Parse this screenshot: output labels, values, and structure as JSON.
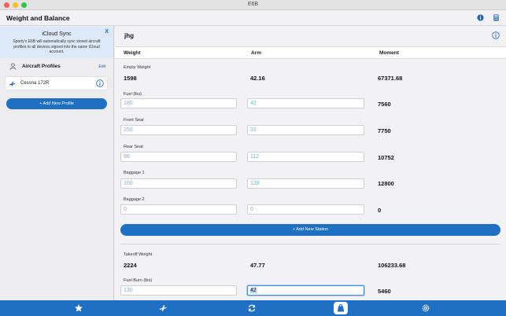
{
  "window": {
    "title": "E6B"
  },
  "header": {
    "title": "Weight and Balance"
  },
  "sidebar": {
    "icloud": {
      "title": "iCloud Sync",
      "description": "Sporty's E6B will automatically sync stored aircraft profiles to all devices signed into the same iCloud account.",
      "close_label": "X"
    },
    "profiles_label": "Aircraft Profiles",
    "edit_label": "Edit",
    "profiles": [
      {
        "name": "Cessna 172R"
      }
    ],
    "add_profile_label": "+ Add New Profile"
  },
  "main": {
    "profile_name": "jhg",
    "columns": {
      "weight": "Weight",
      "arm": "Arm",
      "moment": "Moment"
    },
    "empty_weight": {
      "label": "Empty Weight",
      "weight": "1598",
      "arm": "42.16",
      "moment": "67371.68"
    },
    "stations": [
      {
        "label": "Fuel (lbs)",
        "weight": "180",
        "arm": "42",
        "moment": "7560"
      },
      {
        "label": "Front Seat",
        "weight": "250",
        "arm": "31",
        "moment": "7750"
      },
      {
        "label": "Rear Seat",
        "weight": "96",
        "arm": "112",
        "moment": "10752"
      },
      {
        "label": "Baggage 1",
        "weight": "100",
        "arm": "128",
        "moment": "12800"
      },
      {
        "label": "Baggage 2",
        "weight": "0",
        "arm": "0",
        "moment": "0"
      }
    ],
    "add_station_label": "+ Add New Station",
    "takeoff": {
      "label": "Takeoff Weight",
      "weight": "2224",
      "arm": "47.77",
      "moment": "106233.68"
    },
    "fuel_burn": {
      "label": "Fuel Burn (lbs)",
      "weight": "130",
      "arm": "42",
      "moment": "5460"
    }
  },
  "tabbar": {
    "tabs": [
      {
        "icon": "star-icon"
      },
      {
        "icon": "airplane-icon"
      },
      {
        "icon": "sync-icon"
      },
      {
        "icon": "weight-balance-icon",
        "selected": true
      },
      {
        "icon": "settings-icon"
      }
    ]
  },
  "colors": {
    "accent": "#1f6fc2",
    "banner": "#dbe9f8",
    "input_text": "#7aaedf"
  }
}
